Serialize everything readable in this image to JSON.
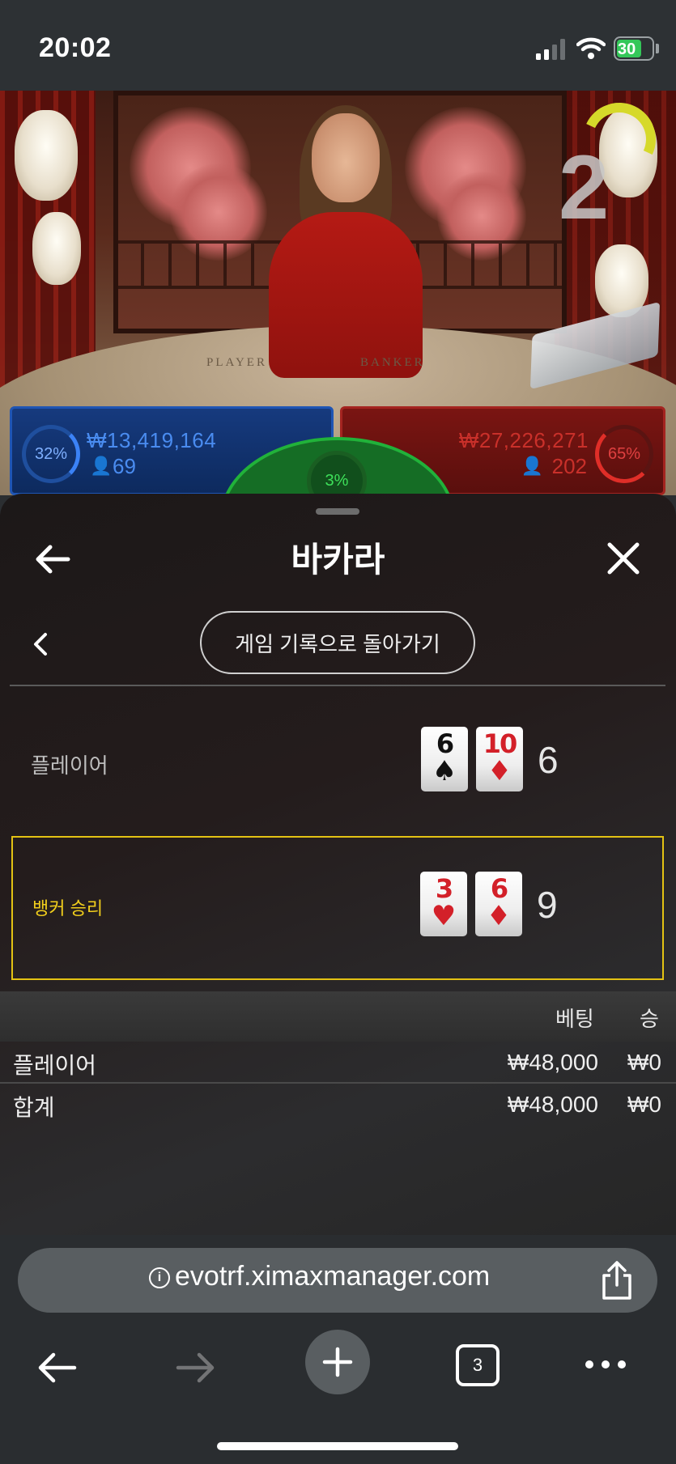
{
  "status_bar": {
    "time": "20:02",
    "battery": "30"
  },
  "game": {
    "timer": "2",
    "table_labels": {
      "player": "PLAYER",
      "banker": "BANKER"
    },
    "player_bets": {
      "percent": "32%",
      "amount": "₩13,419,164",
      "players": "69"
    },
    "banker_bets": {
      "percent": "65%",
      "amount": "₩27,226,271",
      "players": "202"
    },
    "tie_bets": {
      "percent": "3%"
    }
  },
  "sheet": {
    "title": "바카라",
    "history_button": "게임 기록으로 돌아가기",
    "player_hand": {
      "label": "플레이어",
      "cards": [
        {
          "rank": "6",
          "suit": "♠",
          "color": "black"
        },
        {
          "rank": "10",
          "suit": "♦",
          "color": "red"
        }
      ],
      "total": "6"
    },
    "banker_hand": {
      "label": "뱅커 승리",
      "cards": [
        {
          "rank": "3",
          "suit": "♥",
          "color": "red"
        },
        {
          "rank": "6",
          "suit": "♦",
          "color": "red"
        }
      ],
      "total": "9"
    },
    "bets_table": {
      "headers": {
        "bet": "베팅",
        "win": "승"
      },
      "rows": [
        {
          "name": "플레이어",
          "bet": "₩48,000",
          "win": "₩0"
        },
        {
          "name": "합계",
          "bet": "₩48,000",
          "win": "₩0"
        }
      ]
    }
  },
  "browser": {
    "url": "evotrf.ximaxmanager.com",
    "tab_count": "3"
  },
  "colors": {
    "player_blue": "#1f55b4",
    "banker_red": "#a42420",
    "tie_green": "#21b23a",
    "winner_gold": "#e3c213"
  }
}
